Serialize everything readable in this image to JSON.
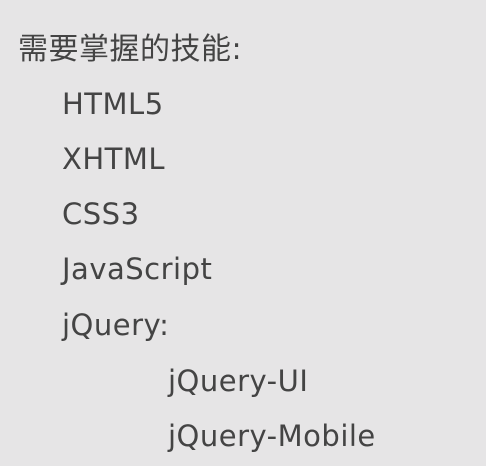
{
  "title": "需要掌握的技能:",
  "skills": [
    "HTML5",
    "XHTML",
    "CSS3",
    "JavaScript",
    "jQuery:"
  ],
  "jquery_sub": [
    "jQuery-UI",
    "jQuery-Mobile"
  ]
}
